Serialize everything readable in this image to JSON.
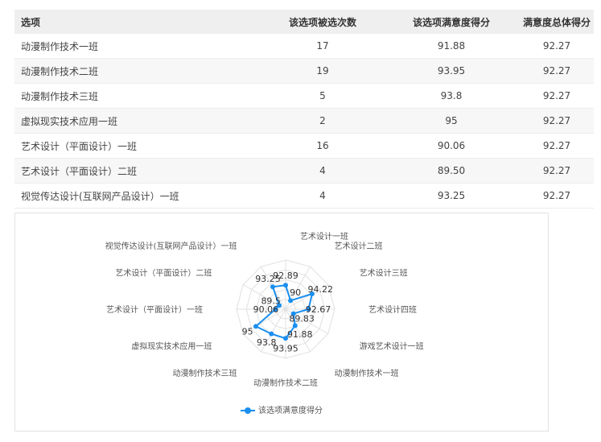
{
  "table": {
    "headers": [
      "选项",
      "该选项被选次数",
      "该选项满意度得分",
      "满意度总体得分"
    ],
    "rows": [
      [
        "动漫制作技术一班",
        "17",
        "91.88",
        "92.27"
      ],
      [
        "动漫制作技术二班",
        "19",
        "93.95",
        "92.27"
      ],
      [
        "动漫制作技术三班",
        "5",
        "93.8",
        "92.27"
      ],
      [
        "虚拟现实技术应用一班",
        "2",
        "95",
        "92.27"
      ],
      [
        "艺术设计（平面设计）一班",
        "16",
        "90.06",
        "92.27"
      ],
      [
        "艺术设计（平面设计）二班",
        "4",
        "89.50",
        "92.27"
      ],
      [
        "视觉传达设计(互联网产品设计）一班",
        "4",
        "93.25",
        "92.27"
      ]
    ]
  },
  "chart_data": {
    "type": "radar",
    "categories": [
      "艺术设计一班",
      "艺术设计二班",
      "艺术设计三班",
      "艺术设计四班",
      "游戏艺术设计一班",
      "动漫制作技术一班",
      "动漫制作技术二班",
      "动漫制作技术三班",
      "虚拟现实技术应用一班",
      "艺术设计（平面设计）一班",
      "艺术设计（平面设计）二班",
      "视觉传达设计(互联网产品设计）一班"
    ],
    "series": [
      {
        "name": "该选项满意度得分",
        "values": [
          92.89,
          90,
          94.22,
          92.67,
          89.83,
          91.88,
          93.95,
          93.8,
          95,
          90.06,
          89.5,
          93.25
        ],
        "labels": [
          "92.89",
          "90",
          "94.22",
          "92.67",
          "89.83",
          "91.88",
          "93.95",
          "93.8",
          "95",
          "90.06",
          "89.5",
          "93.25"
        ]
      }
    ],
    "color": "#1a8ff0",
    "grid_color": "#e0e0e0",
    "legend_position": "bottom"
  }
}
